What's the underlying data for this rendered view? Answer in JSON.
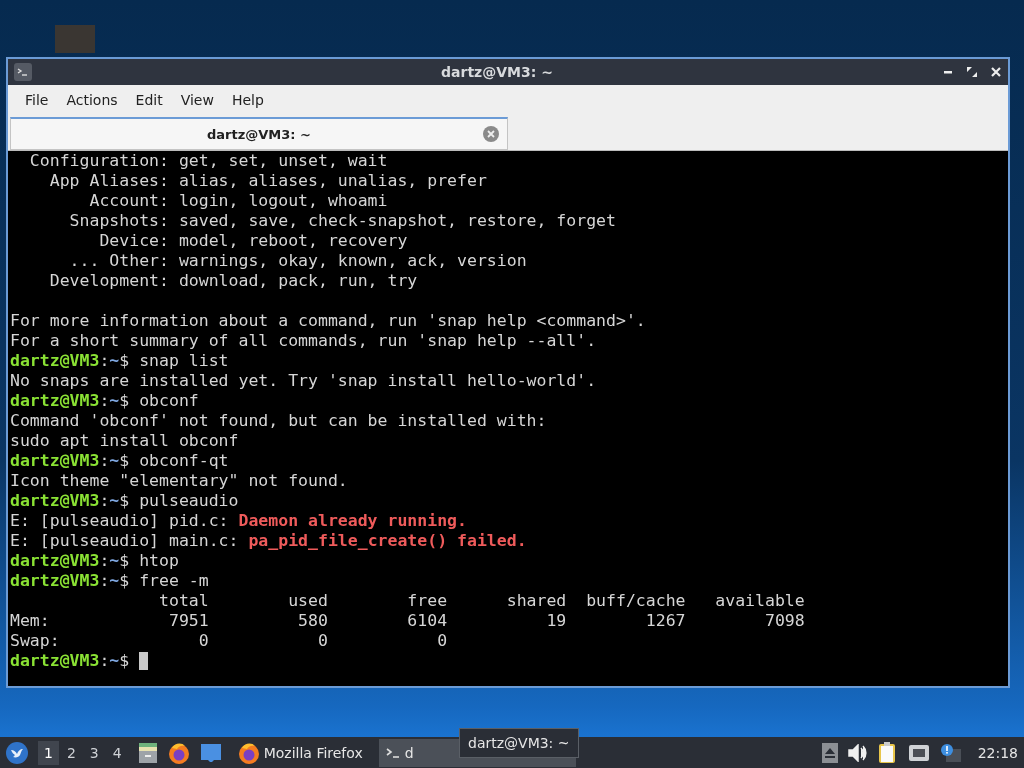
{
  "window": {
    "title": "dartz@VM3: ~"
  },
  "menu": [
    "File",
    "Actions",
    "Edit",
    "View",
    "Help"
  ],
  "tabs": [
    {
      "label": "dartz@VM3: ~",
      "selected": true
    }
  ],
  "terminal": {
    "lines": [
      {
        "kind": "output",
        "parts": [
          {
            "kind": "plain",
            "text": "  Configuration: get, set, unset, wait"
          }
        ]
      },
      {
        "kind": "output",
        "parts": [
          {
            "kind": "plain",
            "text": "    App Aliases: alias, aliases, unalias, prefer"
          }
        ]
      },
      {
        "kind": "output",
        "parts": [
          {
            "kind": "plain",
            "text": "        Account: login, logout, whoami"
          }
        ]
      },
      {
        "kind": "output",
        "parts": [
          {
            "kind": "plain",
            "text": "      Snapshots: saved, save, check-snapshot, restore, forget"
          }
        ]
      },
      {
        "kind": "output",
        "parts": [
          {
            "kind": "plain",
            "text": "         Device: model, reboot, recovery"
          }
        ]
      },
      {
        "kind": "output",
        "parts": [
          {
            "kind": "plain",
            "text": "      ... Other: warnings, okay, known, ack, version"
          }
        ]
      },
      {
        "kind": "output",
        "parts": [
          {
            "kind": "plain",
            "text": "    Development: download, pack, run, try"
          }
        ]
      },
      {
        "kind": "blank"
      },
      {
        "kind": "output",
        "parts": [
          {
            "kind": "plain",
            "text": "For more information about a command, run 'snap help <command>'."
          }
        ]
      },
      {
        "kind": "output",
        "parts": [
          {
            "kind": "plain",
            "text": "For a short summary of all commands, run 'snap help --all'."
          }
        ]
      },
      {
        "kind": "prompt",
        "user": "dartz@VM3",
        "sep": ":",
        "cwd": "~",
        "symbol": "$",
        "command": "snap list"
      },
      {
        "kind": "output",
        "parts": [
          {
            "kind": "plain",
            "text": "No snaps are installed yet. Try 'snap install hello-world'."
          }
        ]
      },
      {
        "kind": "prompt",
        "user": "dartz@VM3",
        "sep": ":",
        "cwd": "~",
        "symbol": "$",
        "command": "obconf"
      },
      {
        "kind": "output",
        "parts": [
          {
            "kind": "plain",
            "text": "Command 'obconf' not found, but can be installed with:"
          }
        ]
      },
      {
        "kind": "output",
        "parts": [
          {
            "kind": "plain",
            "text": "sudo apt install obconf"
          }
        ]
      },
      {
        "kind": "prompt",
        "user": "dartz@VM3",
        "sep": ":",
        "cwd": "~",
        "symbol": "$",
        "command": "obconf-qt"
      },
      {
        "kind": "output",
        "parts": [
          {
            "kind": "plain",
            "text": "Icon theme \"elementary\" not found."
          }
        ]
      },
      {
        "kind": "prompt",
        "user": "dartz@VM3",
        "sep": ":",
        "cwd": "~",
        "symbol": "$",
        "command": "pulseaudio"
      },
      {
        "kind": "output",
        "parts": [
          {
            "kind": "plain",
            "text": "E: [pulseaudio] pid.c: "
          },
          {
            "kind": "error",
            "text": "Daemon already running."
          }
        ]
      },
      {
        "kind": "output",
        "parts": [
          {
            "kind": "plain",
            "text": "E: [pulseaudio] main.c: "
          },
          {
            "kind": "error",
            "text": "pa_pid_file_create() failed."
          }
        ]
      },
      {
        "kind": "prompt",
        "user": "dartz@VM3",
        "sep": ":",
        "cwd": "~",
        "symbol": "$",
        "command": "htop"
      },
      {
        "kind": "prompt",
        "user": "dartz@VM3",
        "sep": ":",
        "cwd": "~",
        "symbol": "$",
        "command": "free -m"
      },
      {
        "kind": "output",
        "parts": [
          {
            "kind": "plain",
            "text": "               total        used        free      shared  buff/cache   available"
          }
        ]
      },
      {
        "kind": "output",
        "parts": [
          {
            "kind": "plain",
            "text": "Mem:            7951         580        6104          19        1267        7098"
          }
        ]
      },
      {
        "kind": "output",
        "parts": [
          {
            "kind": "plain",
            "text": "Swap:              0           0           0"
          }
        ]
      },
      {
        "kind": "prompt",
        "user": "dartz@VM3",
        "sep": ":",
        "cwd": "~",
        "symbol": "$",
        "cursor": true
      }
    ]
  },
  "taskbar": {
    "workspaces": [
      {
        "label": "1",
        "selected": true
      },
      {
        "label": "2",
        "selected": false
      },
      {
        "label": "3",
        "selected": false
      },
      {
        "label": "4",
        "selected": false
      }
    ],
    "tasks": [
      {
        "kind": "firefox",
        "label": "Mozilla Firefox",
        "selected": false
      },
      {
        "kind": "terminal",
        "label": "d",
        "selected": true
      }
    ],
    "tooltip": "dartz@VM3: ~",
    "clock": "22:18"
  }
}
